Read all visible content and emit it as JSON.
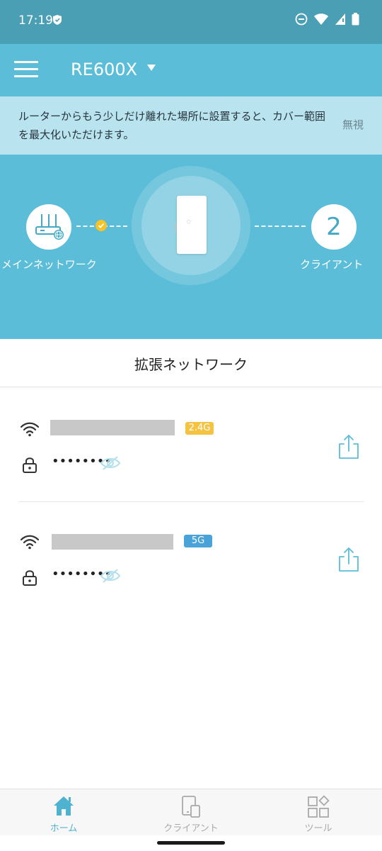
{
  "status_bar": {
    "time": "17:19"
  },
  "header": {
    "device_name": "RE600X"
  },
  "tip": {
    "message": "ルーターからもう少しだけ離れた場所に設置すると、カバー範囲を最大化いただけます。",
    "ignore_label": "無視"
  },
  "topology": {
    "main_network_label": "メインネットワーク",
    "clients_count": "2",
    "clients_label": "クライアント",
    "connection_status_color": "#f7c325"
  },
  "extended_network": {
    "title": "拡張ネットワーク",
    "networks": [
      {
        "band": "2.4G",
        "band_color": "#f5c342",
        "password_masked": "••••••••"
      },
      {
        "band": "5G",
        "band_color": "#4aa3d8",
        "password_masked": "••••••••"
      }
    ]
  },
  "bottom_nav": {
    "items": [
      {
        "label": "ホーム",
        "icon": "home-icon",
        "active": true
      },
      {
        "label": "クライアント",
        "icon": "devices-icon",
        "active": false
      },
      {
        "label": "ツール",
        "icon": "tools-grid-icon",
        "active": false
      }
    ]
  },
  "colors": {
    "accent": "#5bbdd8",
    "status_bar": "#4a9fb5",
    "active_nav": "#4fb3cf"
  }
}
